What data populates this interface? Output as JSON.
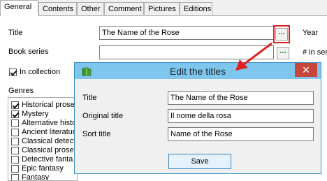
{
  "tabs": [
    "General",
    "Contents",
    "Other",
    "Comment",
    "Pictures",
    "Editions"
  ],
  "form": {
    "title_label": "Title",
    "title_value": "The Name of the Rose",
    "year_label": "Year",
    "series_label": "Book series",
    "series_value": "",
    "number_label": "# in seri",
    "collection_label": "In collection",
    "collection_checked": true,
    "genres_label": "Genres",
    "dots_glyph": "..."
  },
  "genres": [
    {
      "label": "Historical prose",
      "checked": true
    },
    {
      "label": "Mystery",
      "checked": true
    },
    {
      "label": "Alternative histo",
      "checked": false
    },
    {
      "label": "Ancient literatur",
      "checked": false
    },
    {
      "label": "Classical detect",
      "checked": false
    },
    {
      "label": "Classical prose",
      "checked": false
    },
    {
      "label": "Detective fanta",
      "checked": false
    },
    {
      "label": "Epic fantasy",
      "checked": false
    },
    {
      "label": "Fantasy",
      "checked": false
    }
  ],
  "dialog": {
    "title": "Edit the titles",
    "close_glyph": "✕",
    "fields": [
      {
        "label": "Title",
        "value": "The Name of the Rose"
      },
      {
        "label": "Original title",
        "value": "Il nome della rosa"
      },
      {
        "label": "Sort title",
        "value": "Name of the Rose"
      }
    ],
    "save_label": "Save"
  },
  "colors": {
    "annotation_red": "#e02020",
    "dialog_titlebar": "#7fc6ee",
    "close_button": "#c7463b",
    "dots_green": "#1a9a1a"
  }
}
